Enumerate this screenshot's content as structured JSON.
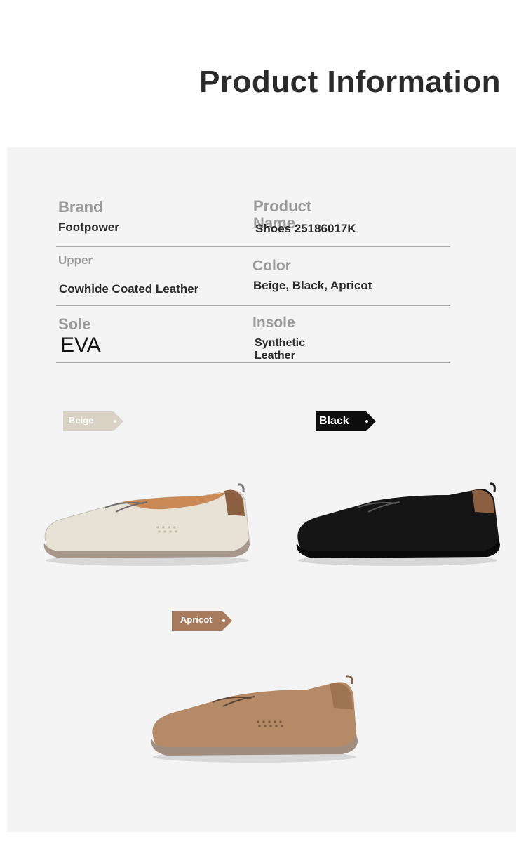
{
  "header": {
    "title": "Product Information"
  },
  "specs": {
    "brand_label": "Brand",
    "brand_value": "Footpower",
    "product_name_label": "Product Name",
    "product_name_value": "Shoes 25186017K",
    "upper_label": "Upper",
    "upper_value": "Cowhide Coated Leather",
    "color_label": "Color",
    "color_value": "Beige, Black, Apricot",
    "sole_label": "Sole",
    "sole_value": "EVA",
    "insole_label": "Insole",
    "insole_value": "Synthetic Leather"
  },
  "variants": [
    {
      "label": "Beige",
      "tag_color": "#d9d2c5",
      "text_color": "#ffffff",
      "shoe_color": "#e7e2d6"
    },
    {
      "label": "Black",
      "tag_color": "#0d0d0d",
      "text_color": "#ffffff",
      "shoe_color": "#151515"
    },
    {
      "label": "Apricot",
      "tag_color": "#a87b5e",
      "text_color": "#ffffff",
      "shoe_color": "#b48a67"
    }
  ]
}
